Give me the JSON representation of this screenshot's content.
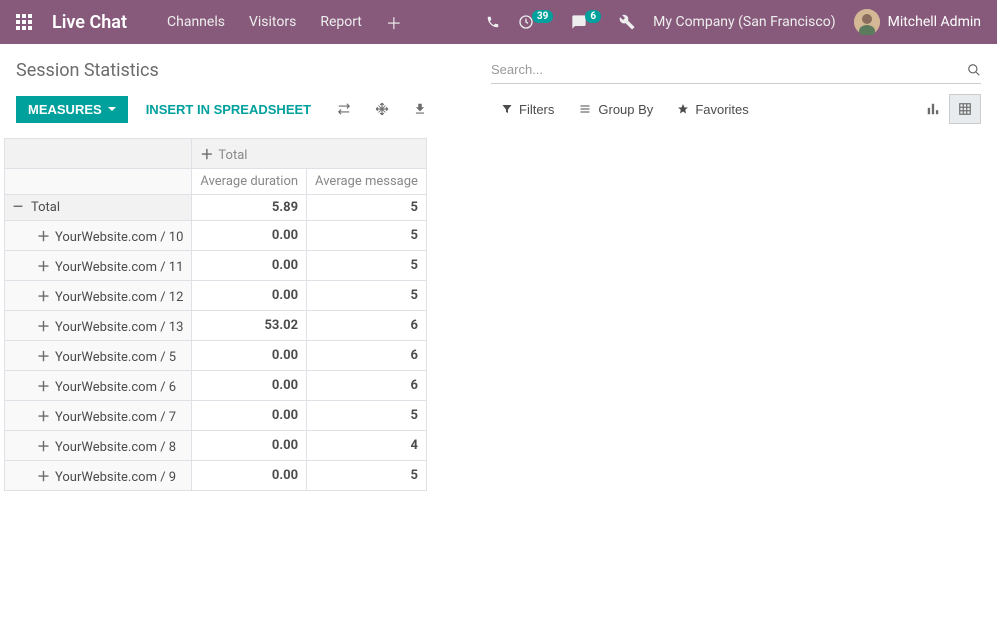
{
  "navbar": {
    "brand": "Live Chat",
    "links": [
      "Channels",
      "Visitors",
      "Report"
    ],
    "activity_badge": "39",
    "msg_badge": "6",
    "company": "My Company (San Francisco)",
    "user": "Mitchell Admin"
  },
  "breadcrumb": "Session Statistics",
  "search": {
    "placeholder": "Search..."
  },
  "buttons": {
    "measures": "MEASURES",
    "insert_spreadsheet": "INSERT IN SPREADSHEET",
    "filters": "Filters",
    "group_by": "Group By",
    "favorites": "Favorites"
  },
  "pivot": {
    "col_header": "Total",
    "measures": [
      "Average duration",
      "Average message"
    ],
    "total_label": "Total",
    "total_values": [
      "5.89",
      "5"
    ],
    "rows": [
      {
        "label": "YourWebsite.com / 10",
        "values": [
          "0.00",
          "5"
        ]
      },
      {
        "label": "YourWebsite.com / 11",
        "values": [
          "0.00",
          "5"
        ]
      },
      {
        "label": "YourWebsite.com / 12",
        "values": [
          "0.00",
          "5"
        ]
      },
      {
        "label": "YourWebsite.com / 13",
        "values": [
          "53.02",
          "6"
        ]
      },
      {
        "label": "YourWebsite.com / 5",
        "values": [
          "0.00",
          "6"
        ]
      },
      {
        "label": "YourWebsite.com / 6",
        "values": [
          "0.00",
          "6"
        ]
      },
      {
        "label": "YourWebsite.com / 7",
        "values": [
          "0.00",
          "5"
        ]
      },
      {
        "label": "YourWebsite.com / 8",
        "values": [
          "0.00",
          "4"
        ]
      },
      {
        "label": "YourWebsite.com / 9",
        "values": [
          "0.00",
          "5"
        ]
      }
    ]
  }
}
